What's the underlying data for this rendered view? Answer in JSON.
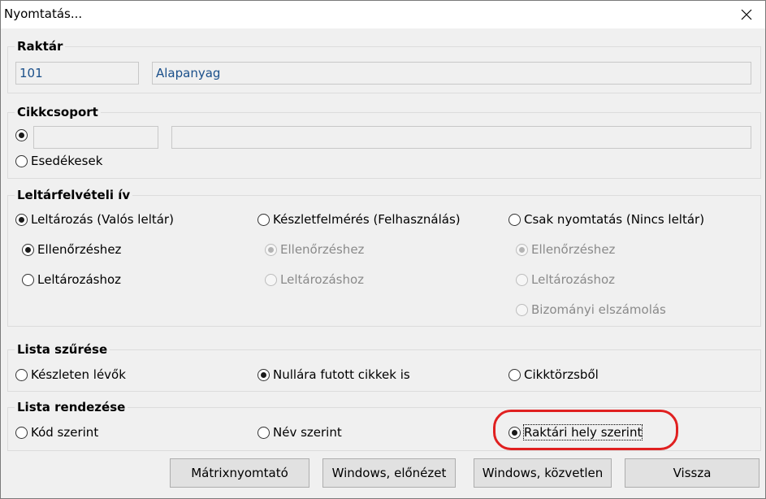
{
  "window": {
    "title": "Nyomtatás..."
  },
  "raktar": {
    "label": "Raktár",
    "code_value": "101",
    "name_value": "Alapanyag"
  },
  "cikkcsoport": {
    "label": "Cikkcsoport",
    "esedekesek_label": "Esedékesek"
  },
  "leltar": {
    "label": "Leltárfelvételi ív",
    "col1": {
      "title": "Leltározás (Valós leltár)",
      "sub1": "Ellenőrzéshez",
      "sub2": "Leltározáshoz"
    },
    "col2": {
      "title": "Készletfelmérés (Felhasználás)",
      "sub1": "Ellenőrzéshez",
      "sub2": "Leltározáshoz"
    },
    "col3": {
      "title": "Csak nyomtatás (Nincs leltár)",
      "sub1": "Ellenőrzéshez",
      "sub2": "Leltározáshoz",
      "sub3": "Bizományi elszámolás"
    }
  },
  "szures": {
    "label": "Lista szűrése",
    "opt1": "Készleten lévők",
    "opt2": "Nullára futott cikkek is",
    "opt3": "Cikktörzsből"
  },
  "rendezes": {
    "label": "Lista rendezése",
    "opt1": "Kód szerint",
    "opt2": "Név szerint",
    "opt3": "Raktári hely szerint"
  },
  "buttons": {
    "matrix": "Mátrixnyomtató",
    "preview": "Windows, előnézet",
    "direct": "Windows, közvetlen",
    "back": "Vissza"
  },
  "colors": {
    "field_text": "#1a4f8a",
    "highlight": "#e02020",
    "dialog_bg": "#f0f0f0"
  }
}
